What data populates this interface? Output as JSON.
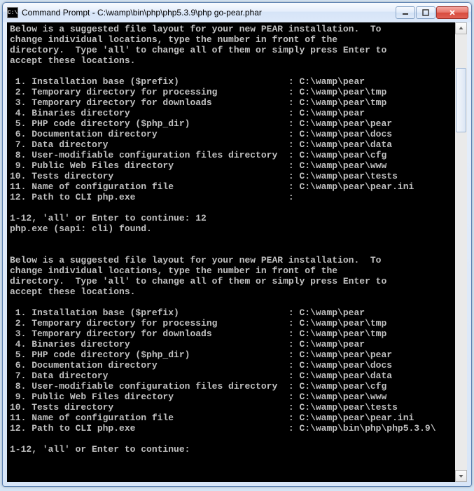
{
  "window": {
    "icon_text": "C:\\",
    "title": "Command Prompt - C:\\wamp\\bin\\php\\php5.3.9\\php  go-pear.phar"
  },
  "intro": "Below is a suggested file layout for your new PEAR installation.  To\nchange individual locations, type the number in front of the\ndirectory.  Type 'all' to change all of them or simply press Enter to\naccept these locations.",
  "items1": [
    {
      "n": " 1",
      "label": "Installation base ($prefix)",
      "path": "C:\\wamp\\pear"
    },
    {
      "n": " 2",
      "label": "Temporary directory for processing",
      "path": "C:\\wamp\\pear\\tmp"
    },
    {
      "n": " 3",
      "label": "Temporary directory for downloads",
      "path": "C:\\wamp\\pear\\tmp"
    },
    {
      "n": " 4",
      "label": "Binaries directory",
      "path": "C:\\wamp\\pear"
    },
    {
      "n": " 5",
      "label": "PHP code directory ($php_dir)",
      "path": "C:\\wamp\\pear\\pear"
    },
    {
      "n": " 6",
      "label": "Documentation directory",
      "path": "C:\\wamp\\pear\\docs"
    },
    {
      "n": " 7",
      "label": "Data directory",
      "path": "C:\\wamp\\pear\\data"
    },
    {
      "n": " 8",
      "label": "User-modifiable configuration files directory",
      "path": "C:\\wamp\\pear\\cfg"
    },
    {
      "n": " 9",
      "label": "Public Web Files directory",
      "path": "C:\\wamp\\pear\\www"
    },
    {
      "n": "10",
      "label": "Tests directory",
      "path": "C:\\wamp\\pear\\tests"
    },
    {
      "n": "11",
      "label": "Name of configuration file",
      "path": "C:\\wamp\\pear\\pear.ini"
    },
    {
      "n": "12",
      "label": "Path to CLI php.exe",
      "path": ""
    }
  ],
  "prompt1": "1-12, 'all' or Enter to continue: 12",
  "found": "php.exe (sapi: cli) found.",
  "items2": [
    {
      "n": " 1",
      "label": "Installation base ($prefix)",
      "path": "C:\\wamp\\pear"
    },
    {
      "n": " 2",
      "label": "Temporary directory for processing",
      "path": "C:\\wamp\\pear\\tmp"
    },
    {
      "n": " 3",
      "label": "Temporary directory for downloads",
      "path": "C:\\wamp\\pear\\tmp"
    },
    {
      "n": " 4",
      "label": "Binaries directory",
      "path": "C:\\wamp\\pear"
    },
    {
      "n": " 5",
      "label": "PHP code directory ($php_dir)",
      "path": "C:\\wamp\\pear\\pear"
    },
    {
      "n": " 6",
      "label": "Documentation directory",
      "path": "C:\\wamp\\pear\\docs"
    },
    {
      "n": " 7",
      "label": "Data directory",
      "path": "C:\\wamp\\pear\\data"
    },
    {
      "n": " 8",
      "label": "User-modifiable configuration files directory",
      "path": "C:\\wamp\\pear\\cfg"
    },
    {
      "n": " 9",
      "label": "Public Web Files directory",
      "path": "C:\\wamp\\pear\\www"
    },
    {
      "n": "10",
      "label": "Tests directory",
      "path": "C:\\wamp\\pear\\tests"
    },
    {
      "n": "11",
      "label": "Name of configuration file",
      "path": "C:\\wamp\\pear\\pear.ini"
    },
    {
      "n": "12",
      "label": "Path to CLI php.exe",
      "path": "C:\\wamp\\bin\\php\\php5.3.9\\"
    }
  ],
  "prompt2": "1-12, 'all' or Enter to continue:"
}
